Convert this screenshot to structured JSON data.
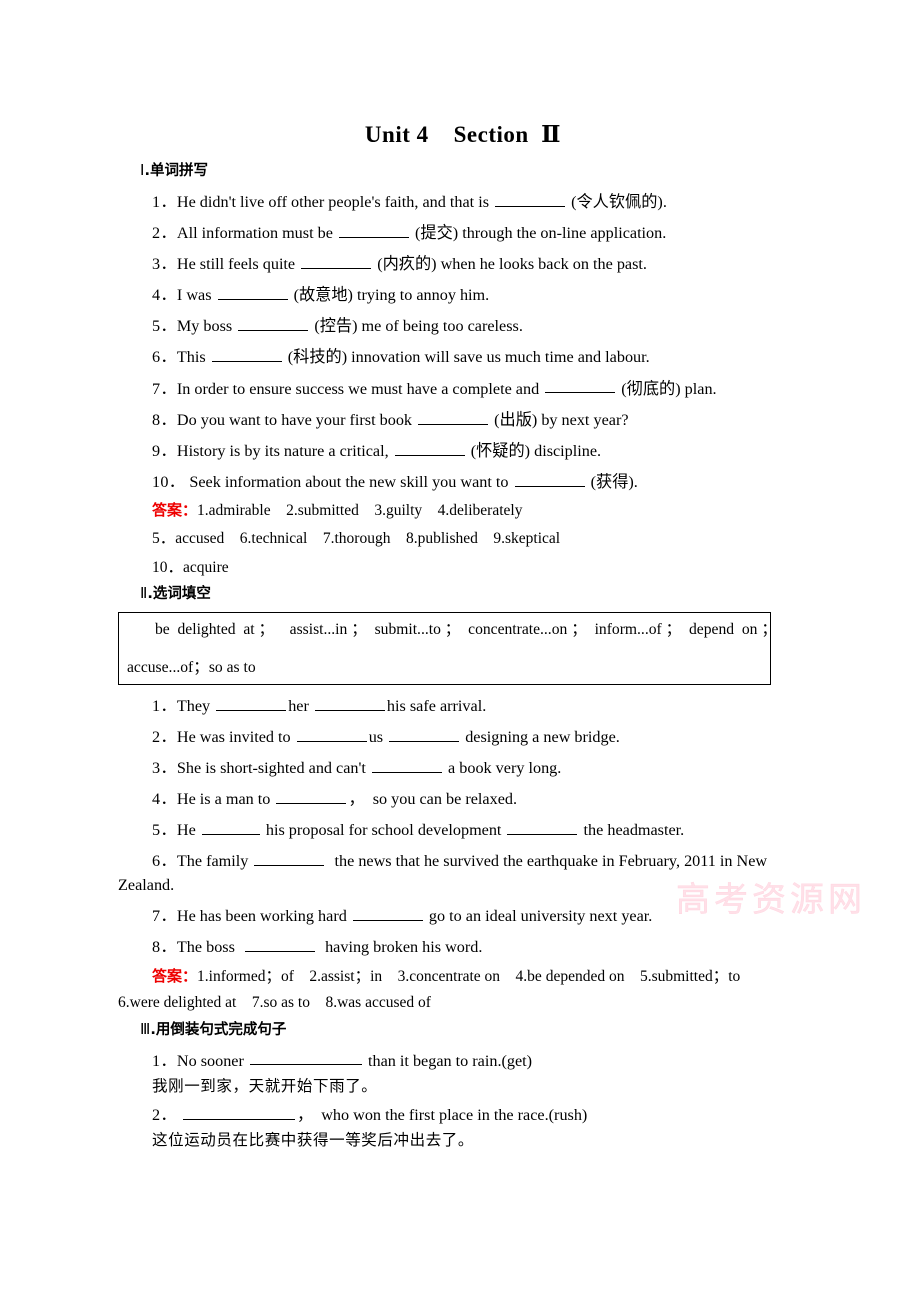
{
  "document": {
    "title": "Unit 4    Section  Ⅱ",
    "watermark": "高考资源网"
  },
  "sections": [
    {
      "heading_roman": "Ⅰ",
      "heading_text": ".单词拼写",
      "questions": [
        {
          "num": "1．",
          "pre": "He didn't live off other people's faith, and that is ",
          "blank": "b-lg",
          "post": " (令人钦佩的)."
        },
        {
          "num": "2．",
          "pre": "All information must be ",
          "blank": "b-lg",
          "post": " (提交) through the on-line application."
        },
        {
          "num": "3．",
          "pre": "He still feels quite ",
          "blank": "b-lg",
          "post": " (内疚的) when he looks back on the past."
        },
        {
          "num": "4．",
          "pre": "I was ",
          "blank": "b-lg",
          "post": " (故意地) trying to annoy him."
        },
        {
          "num": "5．",
          "pre": "My boss ",
          "blank": "b-lg",
          "post": " (控告) me of being too careless."
        },
        {
          "num": "6．",
          "pre": "This ",
          "blank": "b-lg",
          "post": " (科技的) innovation will save us much time and labour."
        },
        {
          "num": "7．",
          "pre": "In order to ensure success we must have a complete and ",
          "blank": "b-lg",
          "post": " (彻底的) plan."
        },
        {
          "num": "8．",
          "pre": "Do you want to have your first book ",
          "blank": "b-lg",
          "post": " (出版) by next year?"
        },
        {
          "num": "9．",
          "pre": "History is by its nature a critical, ",
          "blank": "b-lg",
          "post": " (怀疑的) discipline."
        },
        {
          "num": "10．",
          "pre": " Seek information about the new skill you want to ",
          "blank": "b-lg",
          "post": " (获得)."
        }
      ],
      "answer_label": "答案：",
      "answer_lines": [
        "1.admirable　2.submitted　3.guilty　4.deliberately",
        "5．accused　6.technical　7.thorough　8.published　9.skeptical",
        "10．acquire"
      ]
    },
    {
      "heading_roman": "Ⅱ",
      "heading_text": ".选词填空",
      "wordbank": {
        "row1": "be  delighted  at ；    assist...in ；  submit...to ；  concentrate...on ；  inform...of ；  depend  on ；",
        "row2": "accuse...of；so as to"
      },
      "questions": [
        {
          "num": "1．",
          "pre": "They ",
          "blank": "b-lg",
          "mid": "her ",
          "blank2": "b-lg",
          "post": "his safe arrival."
        },
        {
          "num": "2．",
          "pre": "He was invited to ",
          "blank": "b-lg",
          "mid": "us ",
          "blank2": "b-lg",
          "post": " designing a new bridge."
        },
        {
          "num": "3．",
          "pre": "She is short-sighted and can't ",
          "blank": "b-lg",
          "post": " a book very long."
        },
        {
          "num": "4．",
          "pre": "He is a man to ",
          "blank": "b-lg",
          "post": "，  so you can be relaxed."
        },
        {
          "num": "5．",
          "pre": "He ",
          "blank": "b-md",
          "mid": " his proposal for school development ",
          "blank2": "b-lg",
          "post": " the headmaster."
        },
        {
          "num": "6．",
          "pre": "The family ",
          "blank": "b-lg",
          "post": "  the news that he survived the earthquake in February, 2011 in New"
        },
        {
          "num": "",
          "continuation": "Zealand."
        },
        {
          "num": "7．",
          "pre": "He has been working hard ",
          "blank": "b-lg",
          "post": " go to an ideal university next year."
        },
        {
          "num": "8．",
          "pre": "The boss  ",
          "blank": "b-lg",
          "post": "  having broken his word."
        }
      ],
      "answer_label": "答案：",
      "answer_lines": [
        "1.informed；of　2.assist；in　3.concentrate on　4.be depended on　5.submitted；to",
        "6.were delighted at　7.so as to　8.was accused of"
      ]
    },
    {
      "heading_roman": "Ⅲ",
      "heading_text": ".用倒装句式完成句子",
      "questions": [
        {
          "num": "1．",
          "pre": "No sooner ",
          "blank": "b-xl",
          "post": " than it began to rain.(get)"
        },
        {
          "num": "",
          "chinese": "我刚一到家，天就开始下雨了。"
        },
        {
          "num": "2．",
          "pre": " ",
          "blank": "b-xl",
          "post": "，  who won the first place in the race.(rush)"
        },
        {
          "num": "",
          "chinese": "这位运动员在比赛中获得一等奖后冲出去了。"
        }
      ]
    }
  ]
}
